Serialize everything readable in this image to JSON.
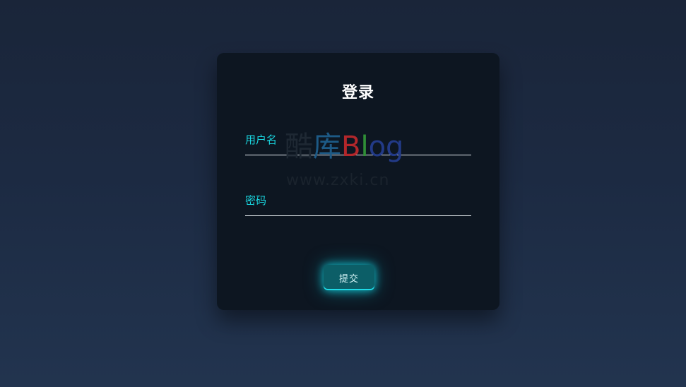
{
  "login": {
    "title": "登录",
    "username_label": "用户名",
    "password_label": "密码",
    "username_value": "",
    "password_value": "",
    "submit_label": "提交"
  },
  "watermark": {
    "char_1": "酷",
    "char_2": "库",
    "b": "B",
    "l": "l",
    "og": "og",
    "url": "www.zxki.cn"
  },
  "colors": {
    "background": "#1c2a42",
    "card": "#0d1621",
    "accent": "#19d6e0",
    "button": "#0c5e67",
    "title": "#ffffff"
  }
}
